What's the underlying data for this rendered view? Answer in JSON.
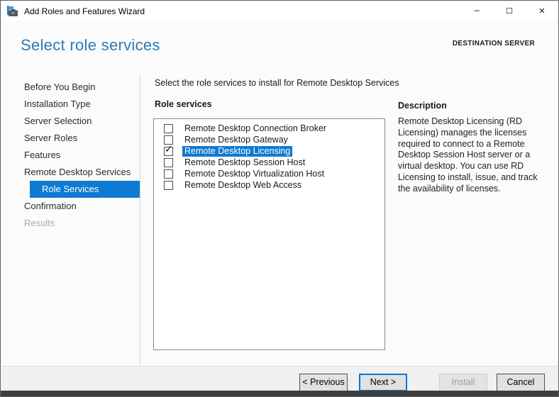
{
  "window": {
    "title": "Add Roles and Features Wizard",
    "controls": {
      "minimize": "─",
      "maximize": "☐",
      "close": "✕"
    }
  },
  "header": {
    "title": "Select role services",
    "destination_label": "DESTINATION SERVER"
  },
  "sidebar": {
    "items": [
      {
        "label": "Before You Begin",
        "state": "normal"
      },
      {
        "label": "Installation Type",
        "state": "normal"
      },
      {
        "label": "Server Selection",
        "state": "normal"
      },
      {
        "label": "Server Roles",
        "state": "normal"
      },
      {
        "label": "Features",
        "state": "normal"
      },
      {
        "label": "Remote Desktop Services",
        "state": "normal"
      },
      {
        "label": "Role Services",
        "state": "selected"
      },
      {
        "label": "Confirmation",
        "state": "normal"
      },
      {
        "label": "Results",
        "state": "disabled"
      }
    ]
  },
  "main": {
    "instruction": "Select the role services to install for Remote Desktop Services",
    "list_label": "Role services",
    "role_services": [
      {
        "label": "Remote Desktop Connection Broker",
        "checked": false,
        "selected": false
      },
      {
        "label": "Remote Desktop Gateway",
        "checked": false,
        "selected": false
      },
      {
        "label": "Remote Desktop Licensing",
        "checked": true,
        "selected": true
      },
      {
        "label": "Remote Desktop Session Host",
        "checked": false,
        "selected": false
      },
      {
        "label": "Remote Desktop Virtualization Host",
        "checked": false,
        "selected": false
      },
      {
        "label": "Remote Desktop Web Access",
        "checked": false,
        "selected": false
      }
    ]
  },
  "description": {
    "title": "Description",
    "body": "Remote Desktop Licensing (RD Licensing) manages the licenses required to connect to a Remote Desktop Session Host server or a virtual desktop. You can use RD Licensing to install, issue, and track the availability of licenses."
  },
  "footer": {
    "buttons": [
      {
        "label": "< Previous",
        "state": "enabled",
        "default": false
      },
      {
        "label": "Next >",
        "state": "enabled",
        "default": true
      },
      {
        "label": "Install",
        "state": "disabled",
        "default": false
      },
      {
        "label": "Cancel",
        "state": "enabled",
        "default": false
      }
    ]
  },
  "icons": {
    "checkmark": "✓"
  },
  "colors": {
    "accent_blue": "#0f7ad1",
    "heading_blue": "#2b7bb9",
    "footer_bg": "#f0f0f0",
    "bottom_strip": "#3f3f3f"
  }
}
